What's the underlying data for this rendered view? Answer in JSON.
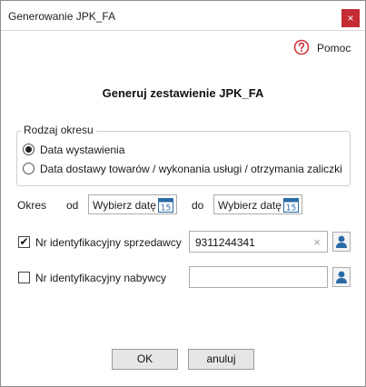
{
  "window": {
    "title": "Generowanie JPK_FA",
    "close_glyph": "×"
  },
  "help": {
    "icon": "help-circle-icon",
    "label": "Pomoc",
    "color": "#d0363d"
  },
  "heading": "Generuj zestawienie JPK_FA",
  "period_group": {
    "legend": "Rodzaj okresu",
    "options": [
      {
        "label": "Data wystawienia",
        "selected": true
      },
      {
        "label": "Data dostawy towarów / wykonania usługi / otrzymania zaliczki",
        "selected": false
      }
    ]
  },
  "period": {
    "label": "Okres",
    "from_label": "od",
    "to_label": "do",
    "from_placeholder": "Wybierz datę",
    "to_placeholder": "Wybierz datę",
    "calendar_icon": "calendar-icon",
    "calendar_day": "15"
  },
  "seller": {
    "checked": true,
    "check_glyph": "✔",
    "label": "Nr identyfikacyjny sprzedawcy",
    "value": "9311244341",
    "clear_glyph": "×"
  },
  "buyer": {
    "checked": false,
    "label": "Nr identyfikacyjny nabywcy",
    "value": ""
  },
  "buttons": {
    "ok": "OK",
    "cancel": "anuluj"
  },
  "colors": {
    "close_bg": "#c42b33",
    "user_icon": "#2b6aa6",
    "calendar_icon": "#2b6aa6"
  }
}
